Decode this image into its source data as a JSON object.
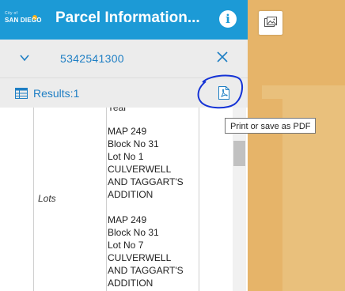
{
  "header": {
    "logo_small": "City of",
    "logo_main": "SAN DIEGO",
    "title": "Parcel Information...",
    "info_icon": "info-icon"
  },
  "feature": {
    "parcel_id": "5342541300",
    "expand_icon": "chevron-down-icon",
    "close_icon": "close-icon"
  },
  "results": {
    "label": "Results:1",
    "table_icon": "table-icon",
    "pdf_icon": "pdf-icon"
  },
  "tooltip": {
    "text": "Print or save as PDF"
  },
  "attributes": {
    "field_name": "Lots",
    "partial_top": "Year",
    "lots": [
      [
        "MAP 249",
        "Block No 31",
        "Lot No 1",
        "CULVERWELL",
        "AND TAGGART'S",
        "ADDITION"
      ],
      [
        "MAP 249",
        "Block No 31",
        "Lot No 7",
        "CULVERWELL",
        "AND TAGGART'S",
        "ADDITION"
      ]
    ]
  },
  "map": {
    "basemap_icon": "basemap-gallery-icon"
  },
  "colors": {
    "header_blue": "#1c9ad6",
    "link_blue": "#1f7fc4",
    "map_orange": "#e6b469",
    "highlight_circle": "#1533d6"
  }
}
